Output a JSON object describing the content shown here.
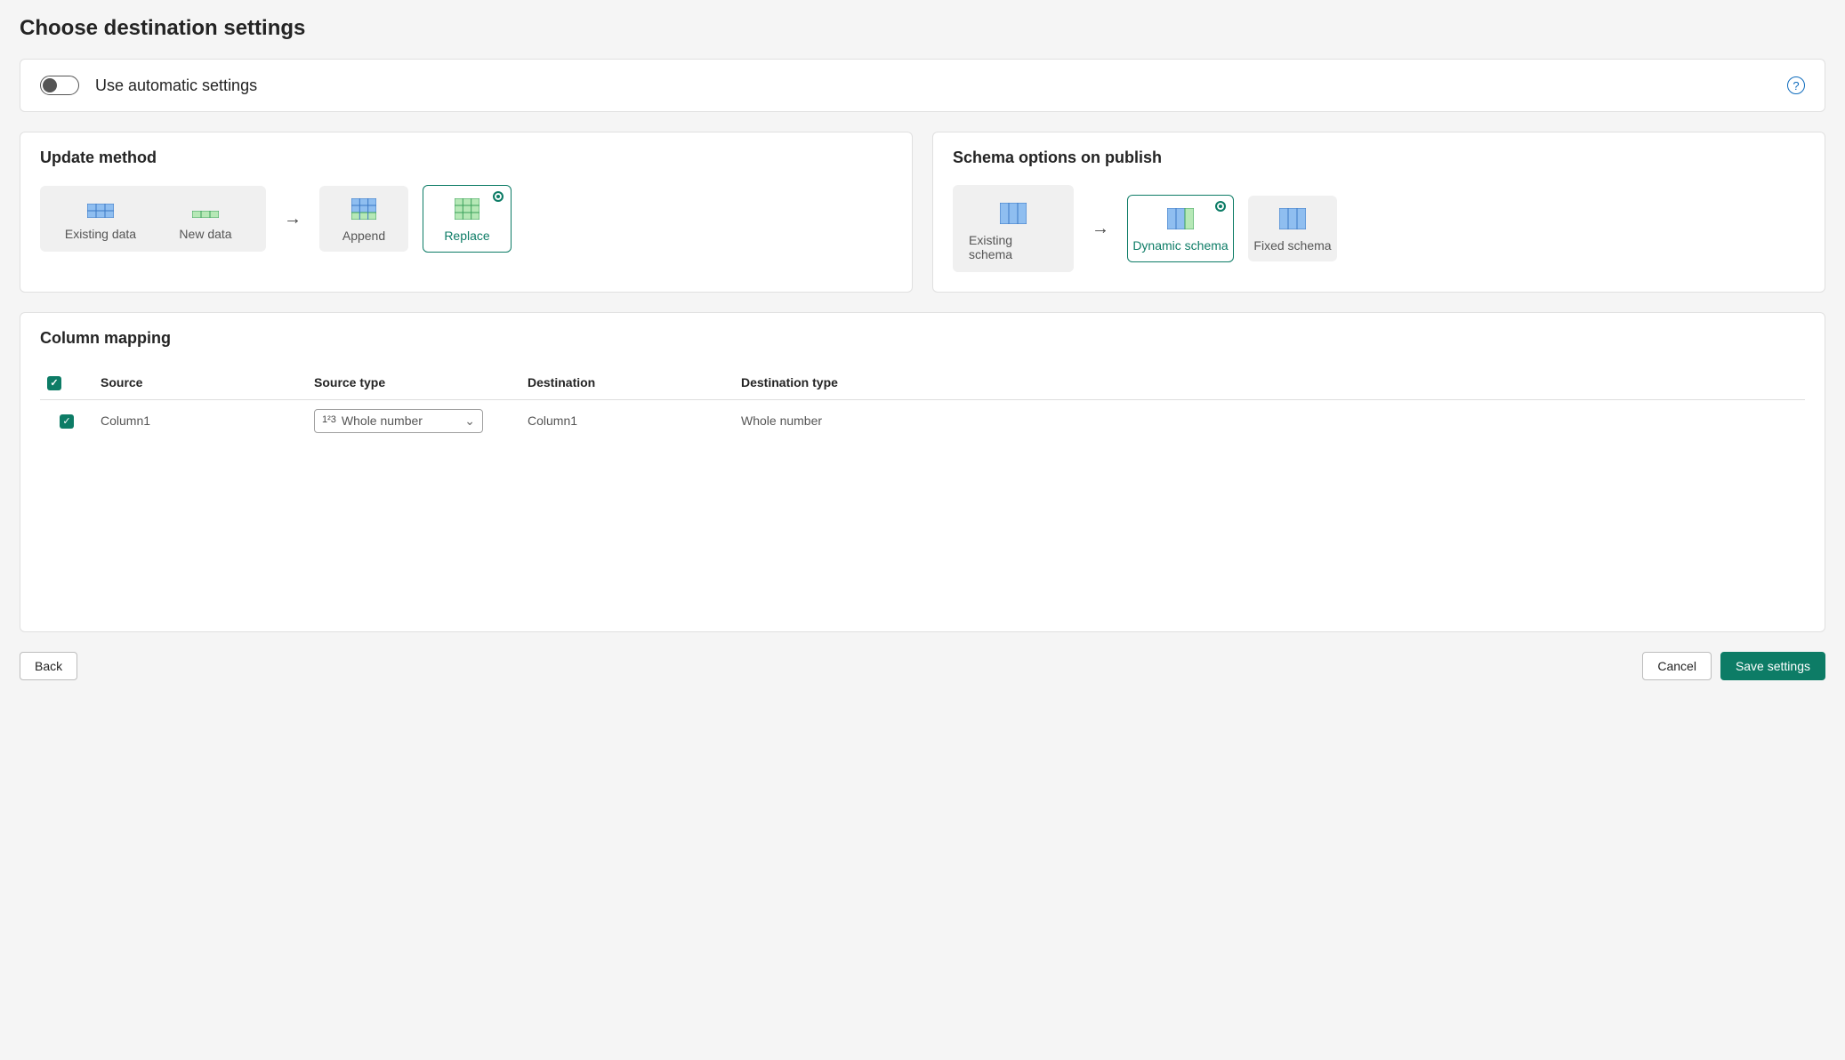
{
  "page_title": "Choose destination settings",
  "auto_settings": {
    "label": "Use automatic settings",
    "enabled": false
  },
  "update_method": {
    "title": "Update method",
    "existing_data": "Existing data",
    "new_data": "New data",
    "options": [
      {
        "id": "append",
        "label": "Append",
        "selected": false
      },
      {
        "id": "replace",
        "label": "Replace",
        "selected": true
      }
    ]
  },
  "schema_options": {
    "title": "Schema options on publish",
    "existing_schema": "Existing schema",
    "options": [
      {
        "id": "dynamic",
        "label": "Dynamic schema",
        "selected": true
      },
      {
        "id": "fixed",
        "label": "Fixed schema",
        "selected": false
      }
    ]
  },
  "column_mapping": {
    "title": "Column mapping",
    "headers": {
      "source": "Source",
      "source_type": "Source type",
      "destination": "Destination",
      "destination_type": "Destination type"
    },
    "rows": [
      {
        "checked": true,
        "source": "Column1",
        "source_type": "Whole number",
        "destination": "Column1",
        "destination_type": "Whole number"
      }
    ]
  },
  "footer": {
    "back": "Back",
    "cancel": "Cancel",
    "save": "Save settings"
  }
}
